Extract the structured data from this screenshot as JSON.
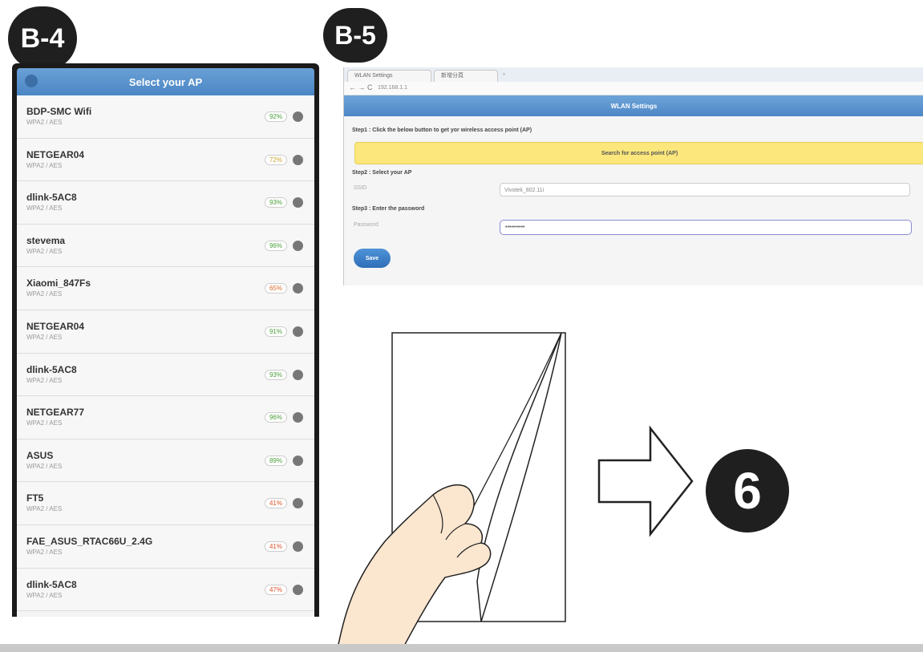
{
  "badges": {
    "b4": "B-4",
    "b5": "B-5",
    "step6": "6"
  },
  "phone": {
    "header_title": "Select your AP",
    "access_points": [
      {
        "name": "BDP-SMC Wifi",
        "security": "WPA2 / AES",
        "signal": "92%",
        "signal_color": "#4a9d3a"
      },
      {
        "name": "NETGEAR04",
        "security": "WPA2 / AES",
        "signal": "72%",
        "signal_color": "#c8a22a"
      },
      {
        "name": "dlink-5AC8",
        "security": "WPA2 / AES",
        "signal": "93%",
        "signal_color": "#4a9d3a"
      },
      {
        "name": "stevema",
        "security": "WPA2 / AES",
        "signal": "96%",
        "signal_color": "#4a9d3a"
      },
      {
        "name": "Xiaomi_847Fs",
        "security": "WPA2 / AES",
        "signal": "65%",
        "signal_color": "#d96a2a"
      },
      {
        "name": "NETGEAR04",
        "security": "WPA2 / AES",
        "signal": "91%",
        "signal_color": "#4a9d3a"
      },
      {
        "name": "dlink-5AC8",
        "security": "WPA2 / AES",
        "signal": "93%",
        "signal_color": "#4a9d3a"
      },
      {
        "name": "NETGEAR77",
        "security": "WPA2 / AES",
        "signal": "96%",
        "signal_color": "#4a9d3a"
      },
      {
        "name": "ASUS",
        "security": "WPA2 / AES",
        "signal": "89%",
        "signal_color": "#4a9d3a"
      },
      {
        "name": "FT5",
        "security": "WPA2 / AES",
        "signal": "41%",
        "signal_color": "#d9532a"
      },
      {
        "name": "FAE_ASUS_RTAC66U_2.4G",
        "security": "WPA2 / AES",
        "signal": "41%",
        "signal_color": "#d9532a"
      },
      {
        "name": "dlink-5AC8",
        "security": "WPA2 / AES",
        "signal": "47%",
        "signal_color": "#d9532a"
      }
    ]
  },
  "browser": {
    "tabs": [
      {
        "label": "WLAN Settings"
      },
      {
        "label": "新增分頁"
      }
    ],
    "url": "192.168.1.1",
    "page_title": "WLAN Settings",
    "step1": "Step1 : Click the below button to get yor wireless access point (AP)",
    "search_button": "Search for access point (AP)",
    "step2": "Step2 : Select your AP",
    "ssid_label": "SSID",
    "ssid_value": "Vivotek_802.11i",
    "step3": "Step3 : Enter the password",
    "password_label": "Password",
    "password_value": "••••••••••",
    "save_button": "Save"
  }
}
